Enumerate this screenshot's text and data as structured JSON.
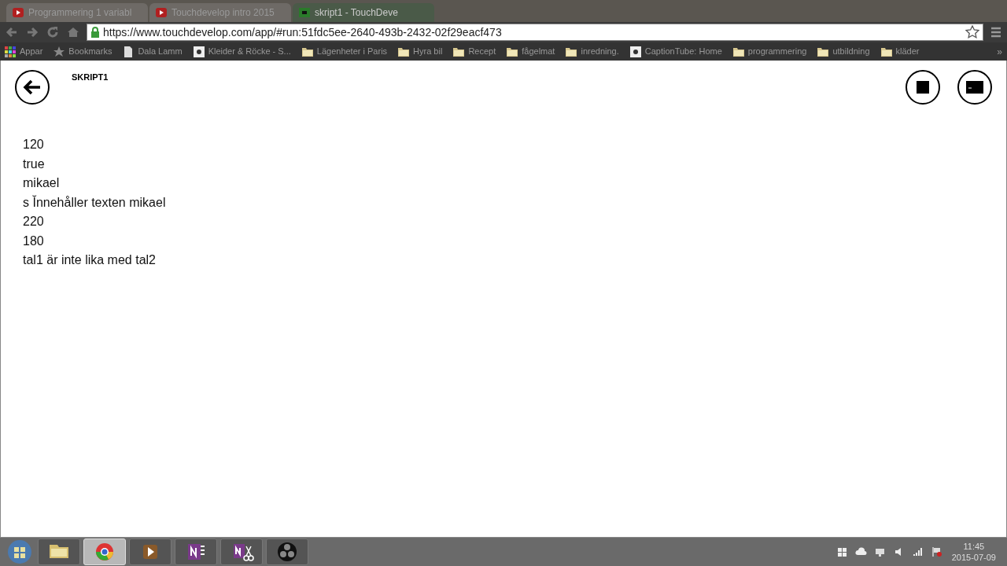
{
  "browser": {
    "tabs": [
      {
        "title": "Programmering 1 variabl",
        "selected": false,
        "kind": "video"
      },
      {
        "title": "Touchdevelop intro 2015",
        "selected": false,
        "kind": "video"
      },
      {
        "title": "skript1 - TouchDeve",
        "selected": true,
        "kind": "app"
      }
    ],
    "address": "https://www.touchdevelop.com/app/#run:51fdc5ee-2640-493b-2432-02f29eacf473",
    "bookmarks": [
      {
        "label": "Appar",
        "kind": "apps"
      },
      {
        "label": "Bookmarks",
        "kind": "star"
      },
      {
        "label": "Dala Lamm",
        "kind": "page"
      },
      {
        "label": "Kleider & Röcke - S...",
        "kind": "site"
      },
      {
        "label": "Lägenheter i Paris",
        "kind": "folder"
      },
      {
        "label": "Hyra bil",
        "kind": "folder"
      },
      {
        "label": "Recept",
        "kind": "folder"
      },
      {
        "label": "fågelmat",
        "kind": "folder"
      },
      {
        "label": "inredning.",
        "kind": "folder"
      },
      {
        "label": "CaptionTube: Home",
        "kind": "site"
      },
      {
        "label": "programmering",
        "kind": "folder"
      },
      {
        "label": "utbildning",
        "kind": "folder"
      },
      {
        "label": "kläder",
        "kind": "folder"
      }
    ],
    "more": "»"
  },
  "app": {
    "title": "SKRIPT1",
    "output": [
      "120",
      "true",
      "mikael",
      "s Ĭnnehåller texten mikael",
      "220",
      "180",
      "tal1 är inte lika med tal2"
    ]
  },
  "taskbar": {
    "apps": [
      {
        "kind": "folder",
        "active": false
      },
      {
        "kind": "chrome",
        "active": true
      },
      {
        "kind": "player",
        "active": false
      },
      {
        "kind": "onenote",
        "active": false
      },
      {
        "kind": "clipper",
        "active": false
      },
      {
        "kind": "obs",
        "active": false
      }
    ],
    "time": "11:45",
    "date": "2015-07-09"
  }
}
